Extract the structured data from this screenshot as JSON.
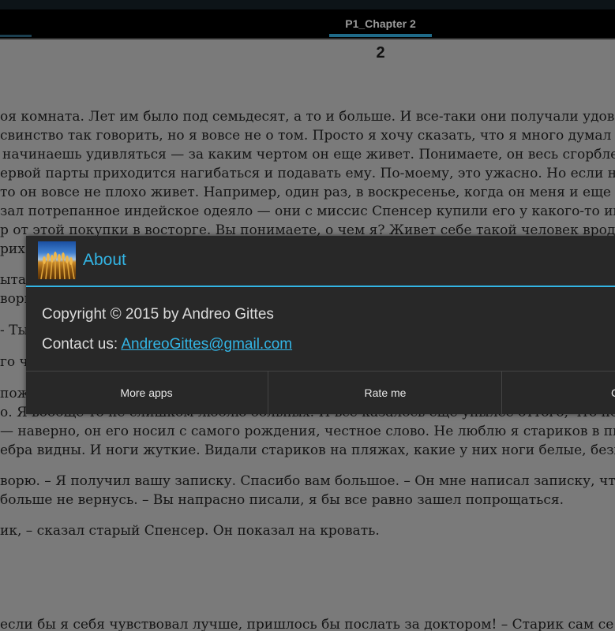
{
  "tab_bar": {
    "active_tab": "P1_Chapter 2"
  },
  "page": {
    "number": "2"
  },
  "book_lines": [
    "оя комната. Лет им было под семьдесят, а то и больше. И все-таки они получали удово",
    "свинство так говорить, но я вовсе не о том. Просто я хочу сказать, что я много думал п",
    "начинаешь удивляться — за каким чертом он еще живет. Понимаете, он весь сгорбле",
    "ервой парты приходится нагибаться и подавать ему. По-моему, это ужасно. Но если н",
    "то он вовсе не плохо живет. Например, один раз, в воскресенье, когда он меня и еще н",
    "зал потрепанное индейское одеяло — они с миссис Спенсер купили его у какого-то ин",
    "р от этой покупки в восторге. Вы понимаете, о чем я? Живет себе такой человек вродс",
    "рих",
    "ыта,",
    "вори",
    "- Ты",
    "го чу",
    "пож",
    "о. Я вообще-то не слишком люблю больных. И все казалось еще унылее оттого, что но",
    "— наверно, он его носил с самого рождения, честное слово. Не люблю я стариков в пи",
    "ебра видны. И ноги жуткие. Видали стариков на пляжах, какие у них ноги белые, безв",
    "ворю. – Я получил вашу записку. Спасибо вам большое. – Он мне написал записку, чт",
    "больше не вернусь. – Вы напрасно писали, я бы все равно зашел попрощаться.",
    "ик, – сказал старый Спенсер. Он показал на кровать.",
    "если бы я себя чувствовал лучше, пришлось бы послать за доктором! – Старик сам се"
  ],
  "dialog": {
    "title": "About",
    "icon": "wheat-field-icon",
    "copyright": "Copyright © 2015 by Andreo Gittes",
    "contact_label": "Contact us: ",
    "contact_email": "AndreoGittes@gmail.com",
    "buttons": {
      "more_apps": "More apps",
      "rate_me": "Rate me",
      "close_partial": "C"
    },
    "accent_color": "#33b5e5"
  }
}
